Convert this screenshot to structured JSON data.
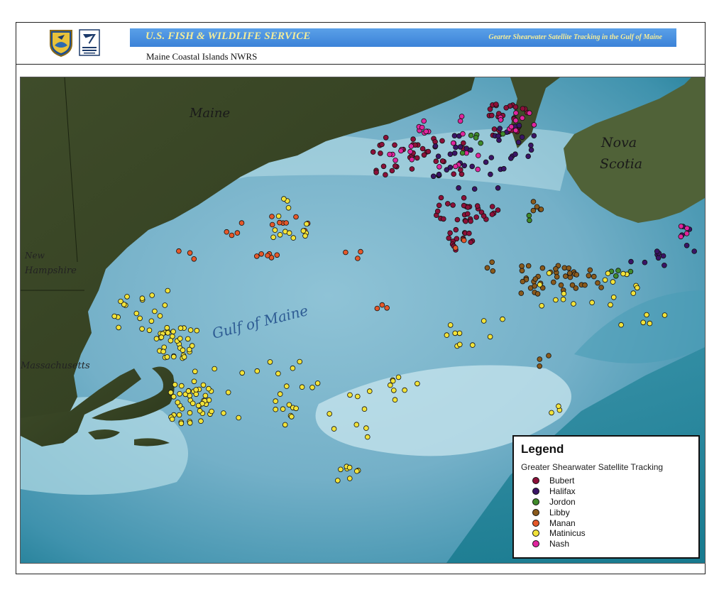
{
  "header": {
    "agency": "U.S. FISH & WILDLIFE SERVICE",
    "map_title": "Gearter Shearwater Satellite Tracking in the Gulf of Maine",
    "subtitle": "Maine Coastal Islands NWRS"
  },
  "map": {
    "labels": {
      "maine": "Maine",
      "nova_scotia_1": "Nova",
      "nova_scotia_2": "Scotia",
      "new_hampshire_1": "New",
      "new_hampshire_2": "Hampshire",
      "massachusetts": "Massachusetts",
      "gulf": "Gulf of Maine"
    }
  },
  "legend": {
    "title": "Legend",
    "subtitle": "Greater Shearwater Satellite Tracking",
    "items": [
      {
        "label": "Bubert",
        "color": "#8c1039"
      },
      {
        "label": "Halifax",
        "color": "#3a1466"
      },
      {
        "label": "Jordon",
        "color": "#3f8a2a"
      },
      {
        "label": "Libby",
        "color": "#8a5a1c"
      },
      {
        "label": "Manan",
        "color": "#e5582a"
      },
      {
        "label": "Matinicus",
        "color": "#f2e33a"
      },
      {
        "label": "Nash",
        "color": "#e0259e"
      }
    ]
  }
}
